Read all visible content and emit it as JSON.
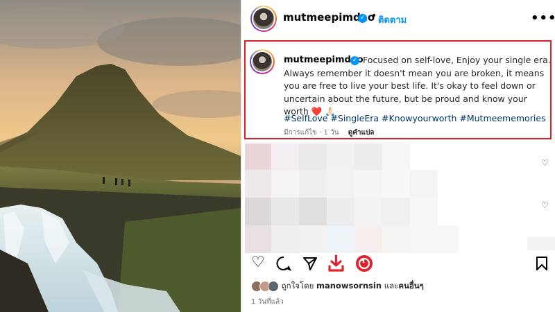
{
  "header": {
    "username": "mutmeepimdao",
    "dot": "•",
    "follow_label": "ติดตาม",
    "more_icon": "more-options-icon"
  },
  "caption": {
    "username": "mutmeepimdao",
    "text": "Focused on self-love, Enjoy your single era. Always remember it doesn't mean you are broken, it means you are free to live your best life. It's okay to feel down or uncertain about the future, but be proud and know your worth ❤️ 🙏🏻",
    "hashtags": "#SelfLove #SingleEra #Knowyourworth #Mutmeememories",
    "edited": "มีการแก้ไข · 1 วัน",
    "translate_label": "ดูคำแปล"
  },
  "likes": {
    "prefix": "ถูกใจโดย",
    "user": "manowsornsin",
    "and": "และ",
    "others": "คนอื่นๆ"
  },
  "timestamp": "1 วันที่แล้ว",
  "colors": {
    "highlight_border": "#d0262b",
    "link_blue": "#0095f6",
    "hashtag": "#00376b",
    "save_red": "#e0242c"
  }
}
